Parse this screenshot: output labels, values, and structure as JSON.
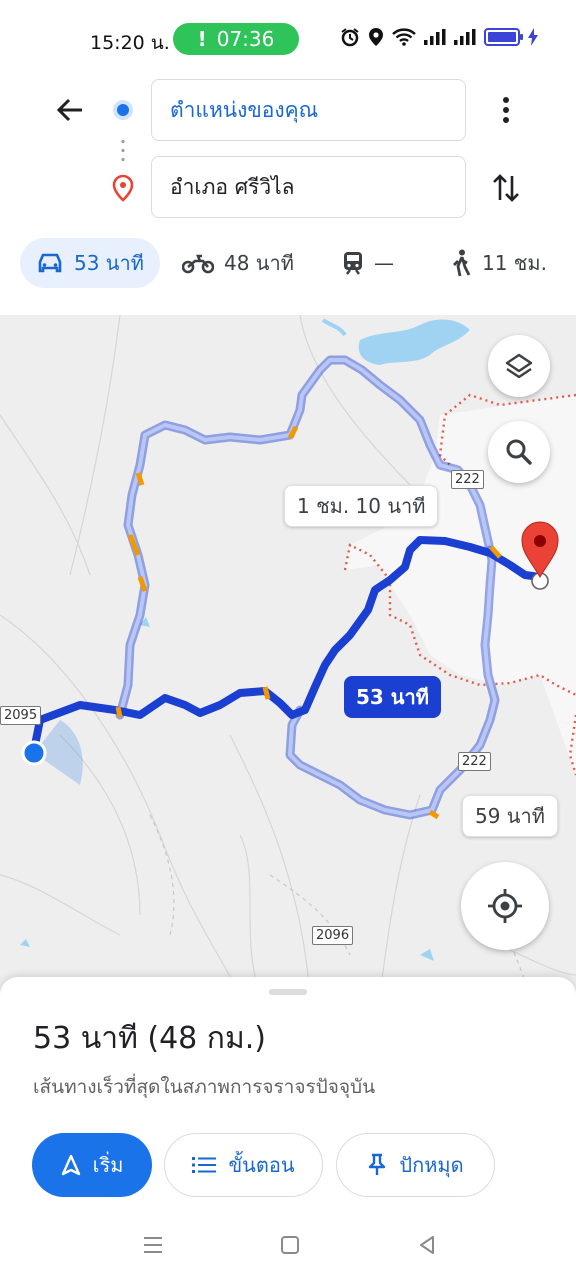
{
  "status_bar": {
    "time": "15:20 น.",
    "call_timer": "07:36",
    "call_indicator": "!",
    "icons": [
      "alarm-icon",
      "location-icon",
      "wifi-icon",
      "signal-icon",
      "signal-icon",
      "battery-icon",
      "charging-icon"
    ]
  },
  "header": {
    "origin": "ตำแหน่งของคุณ",
    "destination": "อำเภอ ศรีวิไล"
  },
  "modes": [
    {
      "name": "car",
      "label": "53 นาที"
    },
    {
      "name": "motorcycle",
      "label": "48 นาที"
    },
    {
      "name": "transit",
      "label": "—"
    },
    {
      "name": "walk",
      "label": "11 ชม."
    }
  ],
  "map": {
    "route_labels": {
      "alt1": "1 ชม. 10 นาที",
      "main": "53 นาที",
      "alt2": "59 นาที"
    },
    "road_shields": {
      "r222a": "222",
      "r222b": "222",
      "r2095": "2095",
      "r2096": "2096"
    },
    "colors": {
      "route_main": "#1a3fd1",
      "route_alt": "#8aa4f0",
      "destination_pin": "#ea4335",
      "boundary": "#e8594c"
    }
  },
  "sheet": {
    "summary": "53 นาที (48 กม.)",
    "subtitle": "เส้นทางเร็วที่สุดในสภาพการจราจรปัจจุบัน",
    "start": "เริ่ม",
    "steps": "ขั้นตอน",
    "pin": "ปักหมุด"
  }
}
